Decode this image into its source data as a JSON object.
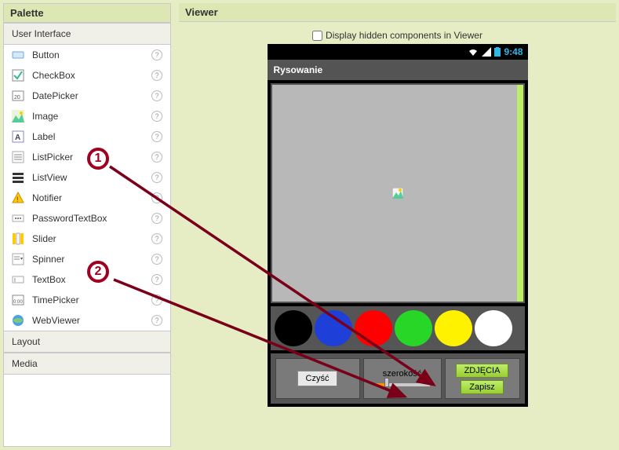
{
  "palette": {
    "title": "Palette",
    "sections": {
      "ui": "User Interface",
      "layout": "Layout",
      "media": "Media"
    },
    "items": [
      {
        "name": "Button",
        "icon": "button-icon"
      },
      {
        "name": "CheckBox",
        "icon": "checkbox-icon"
      },
      {
        "name": "DatePicker",
        "icon": "datepicker-icon"
      },
      {
        "name": "Image",
        "icon": "image-icon"
      },
      {
        "name": "Label",
        "icon": "label-icon"
      },
      {
        "name": "ListPicker",
        "icon": "listpicker-icon"
      },
      {
        "name": "ListView",
        "icon": "listview-icon"
      },
      {
        "name": "Notifier",
        "icon": "notifier-icon"
      },
      {
        "name": "PasswordTextBox",
        "icon": "password-icon"
      },
      {
        "name": "Slider",
        "icon": "slider-icon"
      },
      {
        "name": "Spinner",
        "icon": "spinner-icon"
      },
      {
        "name": "TextBox",
        "icon": "textbox-icon"
      },
      {
        "name": "TimePicker",
        "icon": "timepicker-icon"
      },
      {
        "name": "WebViewer",
        "icon": "webviewer-icon"
      }
    ]
  },
  "viewer": {
    "title": "Viewer",
    "hidden_checkbox_label": "Display hidden components in Viewer",
    "hidden_checkbox_checked": false,
    "status_time": "9:48",
    "app_title": "Rysowanie",
    "colors": [
      "#000000",
      "#1e3fd8",
      "#ff0000",
      "#28d628",
      "#fff200",
      "#ffffff"
    ],
    "buttons": {
      "clear": "Czyść",
      "width_label": "szerokość",
      "photos": "ZDJĘCIA",
      "save": "Zapisz"
    }
  },
  "annotations": {
    "step1": "1",
    "step2": "2"
  }
}
